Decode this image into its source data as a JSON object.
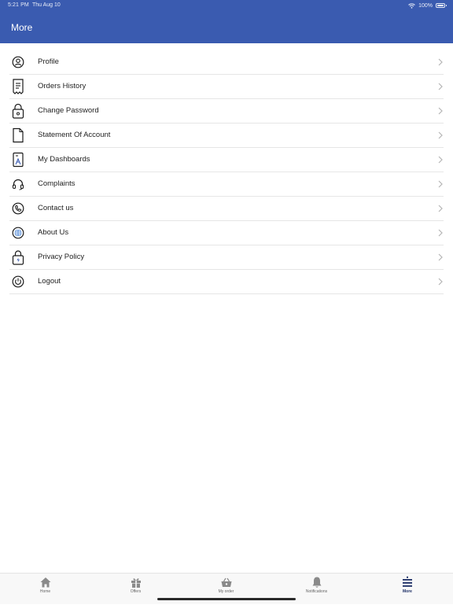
{
  "status_bar": {
    "time": "5:21 PM",
    "date": "Thu Aug 10",
    "battery": "100%",
    "battery_level": 1.0
  },
  "header": {
    "title": "More",
    "background_color": "#3a5bb0"
  },
  "menu": {
    "items": [
      {
        "label": "Profile",
        "icon": "profile-icon"
      },
      {
        "label": "Orders History",
        "icon": "receipt-icon"
      },
      {
        "label": "Change Password",
        "icon": "lock-icon"
      },
      {
        "label": "Statement Of Account",
        "icon": "document-icon"
      },
      {
        "label": "My Dashboards",
        "icon": "dashboard-icon"
      },
      {
        "label": "Complaints",
        "icon": "headset-icon"
      },
      {
        "label": "Contact us",
        "icon": "phone-icon"
      },
      {
        "label": "About Us",
        "icon": "globe-icon"
      },
      {
        "label": "Privacy Policy",
        "icon": "shield-lock-icon"
      },
      {
        "label": "Logout",
        "icon": "power-icon"
      }
    ]
  },
  "tabbar": {
    "tabs": [
      {
        "label": "Home",
        "icon": "home-icon",
        "active": false
      },
      {
        "label": "Offers",
        "icon": "gift-icon",
        "active": false
      },
      {
        "label": "My order",
        "icon": "basket-icon",
        "active": false
      },
      {
        "label": "Notifications",
        "icon": "bell-icon",
        "active": false
      },
      {
        "label": "More",
        "icon": "menu-icon",
        "active": true
      }
    ]
  }
}
